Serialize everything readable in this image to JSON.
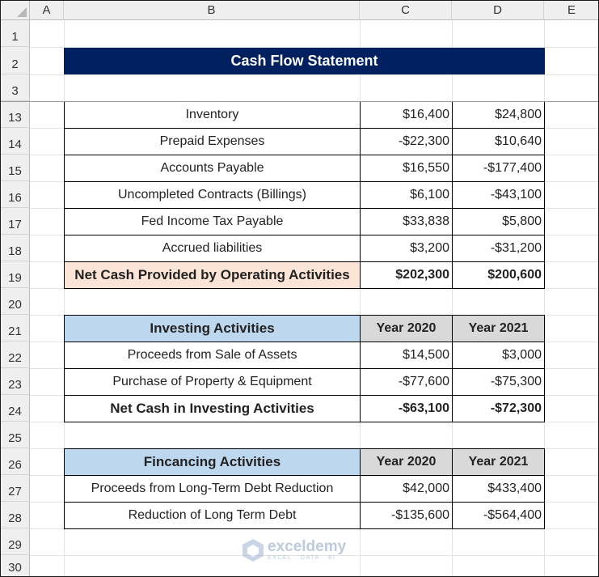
{
  "columns": [
    "A",
    "B",
    "C",
    "D",
    "E"
  ],
  "rows": [
    "1",
    "2",
    "3",
    "13",
    "14",
    "15",
    "16",
    "17",
    "18",
    "19",
    "20",
    "21",
    "22",
    "23",
    "24",
    "25",
    "26",
    "27",
    "28",
    "29",
    "30"
  ],
  "title": "Cash Flow Statement",
  "operating": [
    {
      "label": "Inventory",
      "y2020": "$16,400",
      "y2021": "$24,800"
    },
    {
      "label": "Prepaid Expenses",
      "y2020": "-$22,300",
      "y2021": "$10,640"
    },
    {
      "label": "Accounts Payable",
      "y2020": "$16,550",
      "y2021": "-$177,400"
    },
    {
      "label": "Uncompleted Contracts (Billings)",
      "y2020": "$6,100",
      "y2021": "-$43,100"
    },
    {
      "label": "Fed Income Tax Payable",
      "y2020": "$33,838",
      "y2021": "$5,800"
    },
    {
      "label": "Accrued liabilities",
      "y2020": "$3,200",
      "y2021": "-$31,200"
    }
  ],
  "operating_total": {
    "label": "Net Cash Provided by Operating Activities",
    "y2020": "$202,300",
    "y2021": "$200,600"
  },
  "investing": {
    "header": "Investing Activities",
    "year1": "Year 2020",
    "year2": "Year 2021",
    "rows": [
      {
        "label": "Proceeds from Sale of Assets",
        "y2020": "$14,500",
        "y2021": "$3,000"
      },
      {
        "label": "Purchase of Property & Equipment",
        "y2020": "-$77,600",
        "y2021": "-$75,300"
      }
    ],
    "total": {
      "label": "Net Cash in Investing Activities",
      "y2020": "-$63,100",
      "y2021": "-$72,300"
    }
  },
  "financing": {
    "header": "Fincancing Activities",
    "year1": "Year 2020",
    "year2": "Year 2021",
    "rows": [
      {
        "label": "Proceeds from Long-Term Debt Reduction",
        "y2020": "$42,000",
        "y2021": "$433,400"
      },
      {
        "label": "Reduction of Long Term Debt",
        "y2020": "-$135,600",
        "y2021": "-$564,400"
      }
    ]
  },
  "watermark": {
    "name": "exceldemy",
    "tagline": "EXCEL · DATA · BI"
  },
  "colors": {
    "title_bg": "#002060",
    "section_bg": "#bdd7ee",
    "year_bg": "#d9d9d9",
    "total_bg": "#fce4d6"
  }
}
